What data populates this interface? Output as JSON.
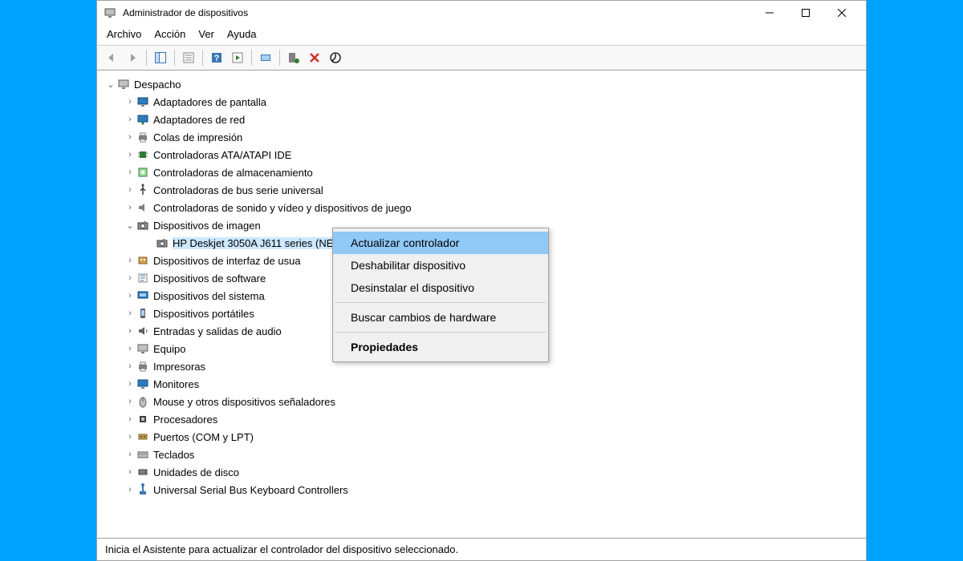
{
  "window": {
    "title": "Administrador de dispositivos"
  },
  "menu": {
    "file": "Archivo",
    "action": "Acción",
    "view": "Ver",
    "help": "Ayuda"
  },
  "tree": {
    "root": "Despacho",
    "items": [
      {
        "label": "Adaptadores de pantalla",
        "icon": "monitor"
      },
      {
        "label": "Adaptadores de red",
        "icon": "network"
      },
      {
        "label": "Colas de impresión",
        "icon": "printer"
      },
      {
        "label": "Controladoras ATA/ATAPI IDE",
        "icon": "chip"
      },
      {
        "label": "Controladoras de almacenamiento",
        "icon": "storage"
      },
      {
        "label": "Controladoras de bus serie universal",
        "icon": "usb"
      },
      {
        "label": "Controladoras de sonido y vídeo y dispositivos de juego",
        "icon": "sound"
      },
      {
        "label": "Dispositivos de imagen",
        "icon": "camera",
        "expanded": true,
        "children": [
          {
            "label": "HP Deskjet 3050A J611 series (NET)",
            "icon": "camera",
            "selected": true
          }
        ]
      },
      {
        "label": "Dispositivos de interfaz de usua",
        "icon": "hid"
      },
      {
        "label": "Dispositivos de software",
        "icon": "software"
      },
      {
        "label": "Dispositivos del sistema",
        "icon": "system"
      },
      {
        "label": "Dispositivos portátiles",
        "icon": "portable"
      },
      {
        "label": "Entradas y salidas de audio",
        "icon": "audio"
      },
      {
        "label": "Equipo",
        "icon": "computer"
      },
      {
        "label": "Impresoras",
        "icon": "printer"
      },
      {
        "label": "Monitores",
        "icon": "monitor"
      },
      {
        "label": "Mouse y otros dispositivos señaladores",
        "icon": "mouse"
      },
      {
        "label": "Procesadores",
        "icon": "cpu"
      },
      {
        "label": "Puertos (COM y LPT)",
        "icon": "port"
      },
      {
        "label": "Teclados",
        "icon": "keyboard"
      },
      {
        "label": "Unidades de disco",
        "icon": "disk"
      },
      {
        "label": "Universal Serial Bus Keyboard Controllers",
        "icon": "usbkb"
      }
    ]
  },
  "context_menu": {
    "update": "Actualizar controlador",
    "disable": "Deshabilitar dispositivo",
    "uninstall": "Desinstalar el dispositivo",
    "scan": "Buscar cambios de hardware",
    "properties": "Propiedades"
  },
  "statusbar": {
    "text": "Inicia el Asistente para actualizar el controlador del dispositivo seleccionado."
  }
}
